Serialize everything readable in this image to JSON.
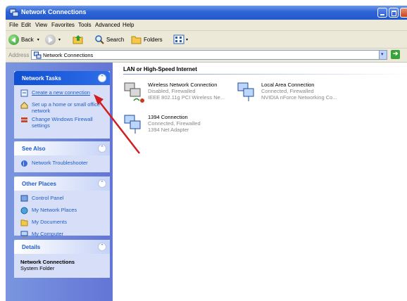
{
  "window": {
    "title": "Network Connections"
  },
  "menu": [
    "File",
    "Edit",
    "View",
    "Favorites",
    "Tools",
    "Advanced",
    "Help"
  ],
  "toolbar": {
    "back_label": "Back",
    "search_label": "Search",
    "folders_label": "Folders"
  },
  "address": {
    "label": "Address",
    "value": "Network Connections",
    "go_label": "Go"
  },
  "sidebar": {
    "network_tasks": {
      "title": "Network Tasks",
      "items": [
        {
          "label": "Create a new connection",
          "icon": "new-connection-icon"
        },
        {
          "label": "Set up a home or small office network",
          "icon": "home-network-icon"
        },
        {
          "label": "Change Windows Firewall settings",
          "icon": "firewall-icon"
        }
      ]
    },
    "see_also": {
      "title": "See Also",
      "items": [
        {
          "label": "Network Troubleshooter",
          "icon": "help-icon"
        }
      ]
    },
    "other_places": {
      "title": "Other Places",
      "items": [
        {
          "label": "Control Panel",
          "icon": "control-panel-icon"
        },
        {
          "label": "My Network Places",
          "icon": "network-places-icon"
        },
        {
          "label": "My Documents",
          "icon": "documents-icon"
        },
        {
          "label": "My Computer",
          "icon": "computer-icon"
        }
      ]
    },
    "details": {
      "title": "Details",
      "name": "Network Connections",
      "type": "System Folder"
    }
  },
  "main": {
    "group_title": "LAN or High-Speed Internet",
    "connections": [
      {
        "name": "Wireless Network Connection",
        "status": "Disabled, Firewalled",
        "device": "IEEE 802.11g PCI Wireless Ne..."
      },
      {
        "name": "Local Area Connection",
        "status": "Connected, Firewalled",
        "device": "NVIDIA nForce Networking Co..."
      },
      {
        "name": "1394 Connection",
        "status": "Connected, Firewalled",
        "device": "1394 Net Adapter"
      }
    ]
  },
  "colors": {
    "titlebar": "#2d63d8",
    "sidebar": "#6375d6",
    "link": "#215dc6",
    "annotation_arrow": "#d11f1f"
  }
}
